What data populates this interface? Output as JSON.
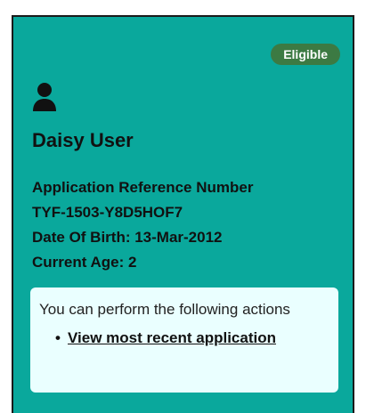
{
  "card": {
    "status_badge": "Eligible",
    "user_icon": "user-icon",
    "name": "Daisy User",
    "reference_label": "Application Reference Number",
    "reference_number": "TYF-1503-Y8D5HOF7",
    "date_of_birth": "Date Of Birth: 13-Mar-2012",
    "current_age": "Current Age: 2",
    "actions": {
      "intro": "You can perform the following actions",
      "items": [
        {
          "label": "View most recent application"
        }
      ]
    }
  },
  "colors": {
    "card_background": "#0aa89c",
    "badge_background": "#3c7a43",
    "actions_background": "#eaffff"
  }
}
